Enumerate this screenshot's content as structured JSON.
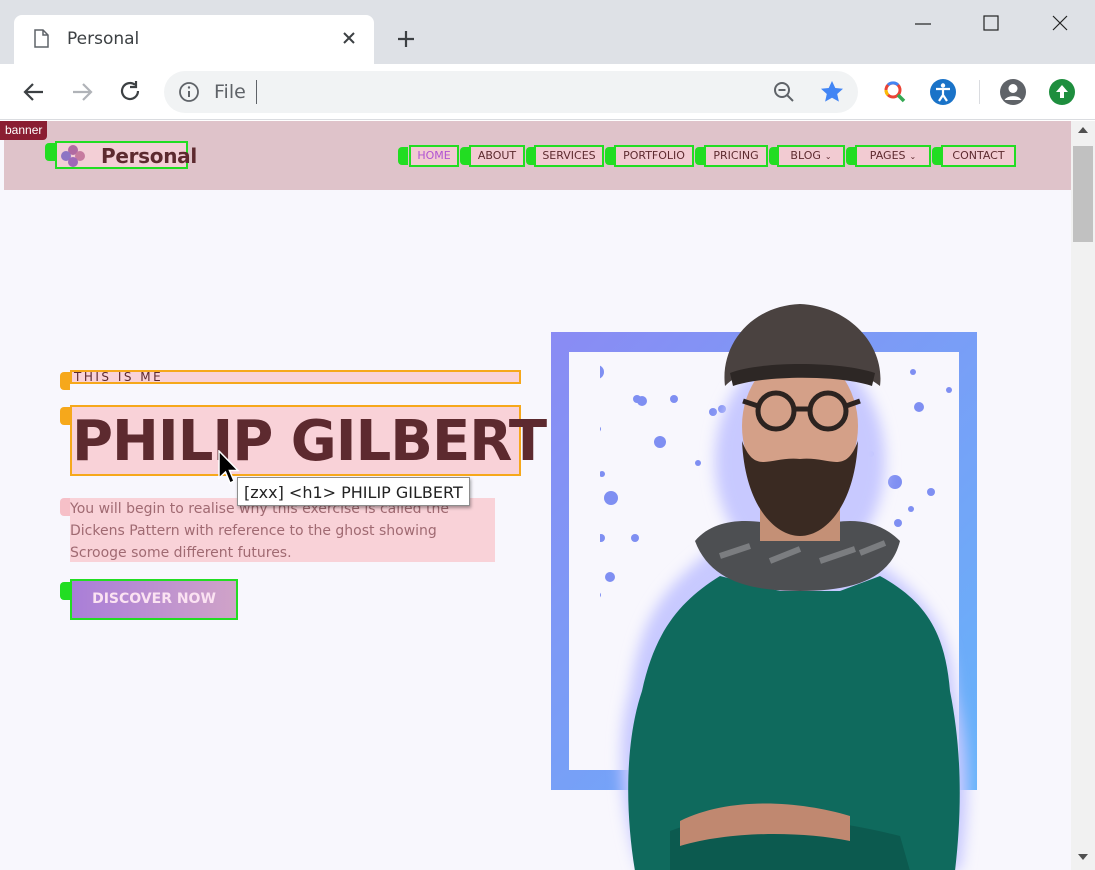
{
  "browser": {
    "tab_title": "Personal",
    "url": "File",
    "icons": [
      "page-icon",
      "close-icon",
      "plus-icon",
      "minimize-icon",
      "maximize-icon",
      "close-window-icon",
      "back-icon",
      "forward-icon",
      "reload-icon",
      "info-icon",
      "zoom-out-icon",
      "star-icon",
      "lens-extension-icon",
      "accessibility-icon",
      "profile-icon",
      "update-icon"
    ]
  },
  "overlay": {
    "banner_label": "banner",
    "tooltip": "[zxx] <h1> PHILIP GILBERT"
  },
  "site": {
    "brand": "Personal",
    "menu": [
      {
        "label": "HOME",
        "active": true
      },
      {
        "label": "ABOUT"
      },
      {
        "label": "SERVICES"
      },
      {
        "label": "PORTFOLIO"
      },
      {
        "label": "PRICING"
      },
      {
        "label": "BLOG",
        "dropdown": true
      },
      {
        "label": "PAGES",
        "dropdown": true
      },
      {
        "label": "CONTACT"
      }
    ],
    "menu_caret": "⌄"
  },
  "hero": {
    "eyebrow": "THIS IS ME",
    "name": "PHILIP GILBERT",
    "description": "You will begin to realise why this exercise is called the Dickens Pattern with reference to the ghost showing Scrooge some different futures.",
    "cta": "DISCOVER NOW"
  },
  "colors": {
    "accent": "#b053d2",
    "heading": "#5d2a2f",
    "frame_start": "#8a8bf4",
    "frame_end": "#66b3fa",
    "sweater": "#0f6a5d"
  }
}
